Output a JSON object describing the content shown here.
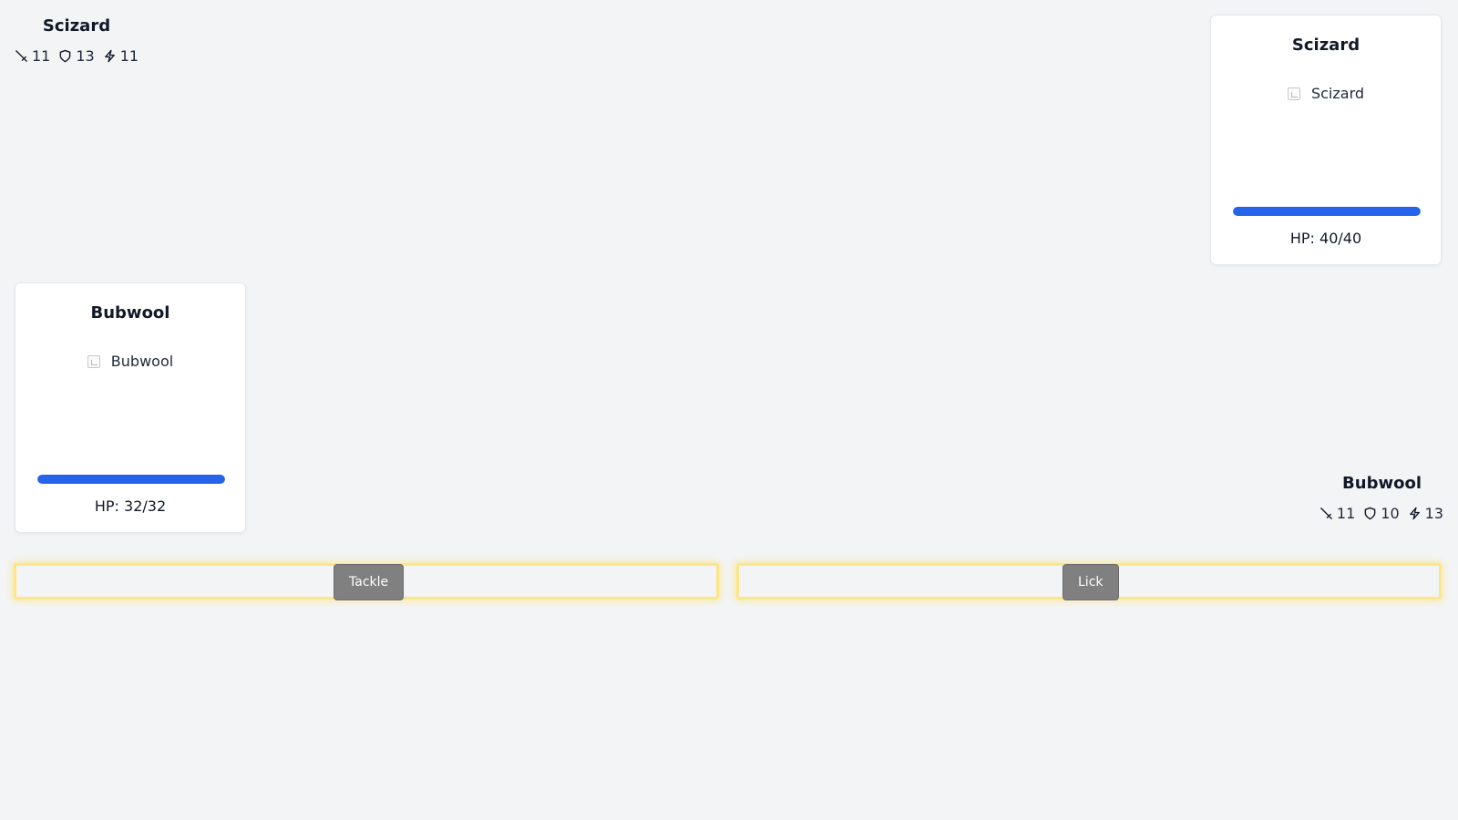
{
  "enemy": {
    "name": "Scizard",
    "stats": {
      "attack": "11",
      "defense": "13",
      "speed": "11"
    },
    "card": {
      "name": "Scizard",
      "sprite_alt": "Scizard",
      "hp_text": "HP: 40/40",
      "hp_fraction": 1.0
    }
  },
  "player": {
    "name": "Bubwool",
    "stats": {
      "attack": "11",
      "defense": "10",
      "speed": "13"
    },
    "card": {
      "name": "Bubwool",
      "sprite_alt": "Bubwool",
      "hp_text": "HP: 32/32",
      "hp_fraction": 1.0
    }
  },
  "moves": [
    {
      "label": "Tackle"
    },
    {
      "label": "Lick"
    }
  ],
  "icons": {
    "attack": "sword-icon",
    "defense": "shield-icon",
    "speed": "lightning-icon"
  },
  "colors": {
    "hp_bar": "#2563eb",
    "move_button": "#808080",
    "slot_highlight": "#fde68a"
  }
}
